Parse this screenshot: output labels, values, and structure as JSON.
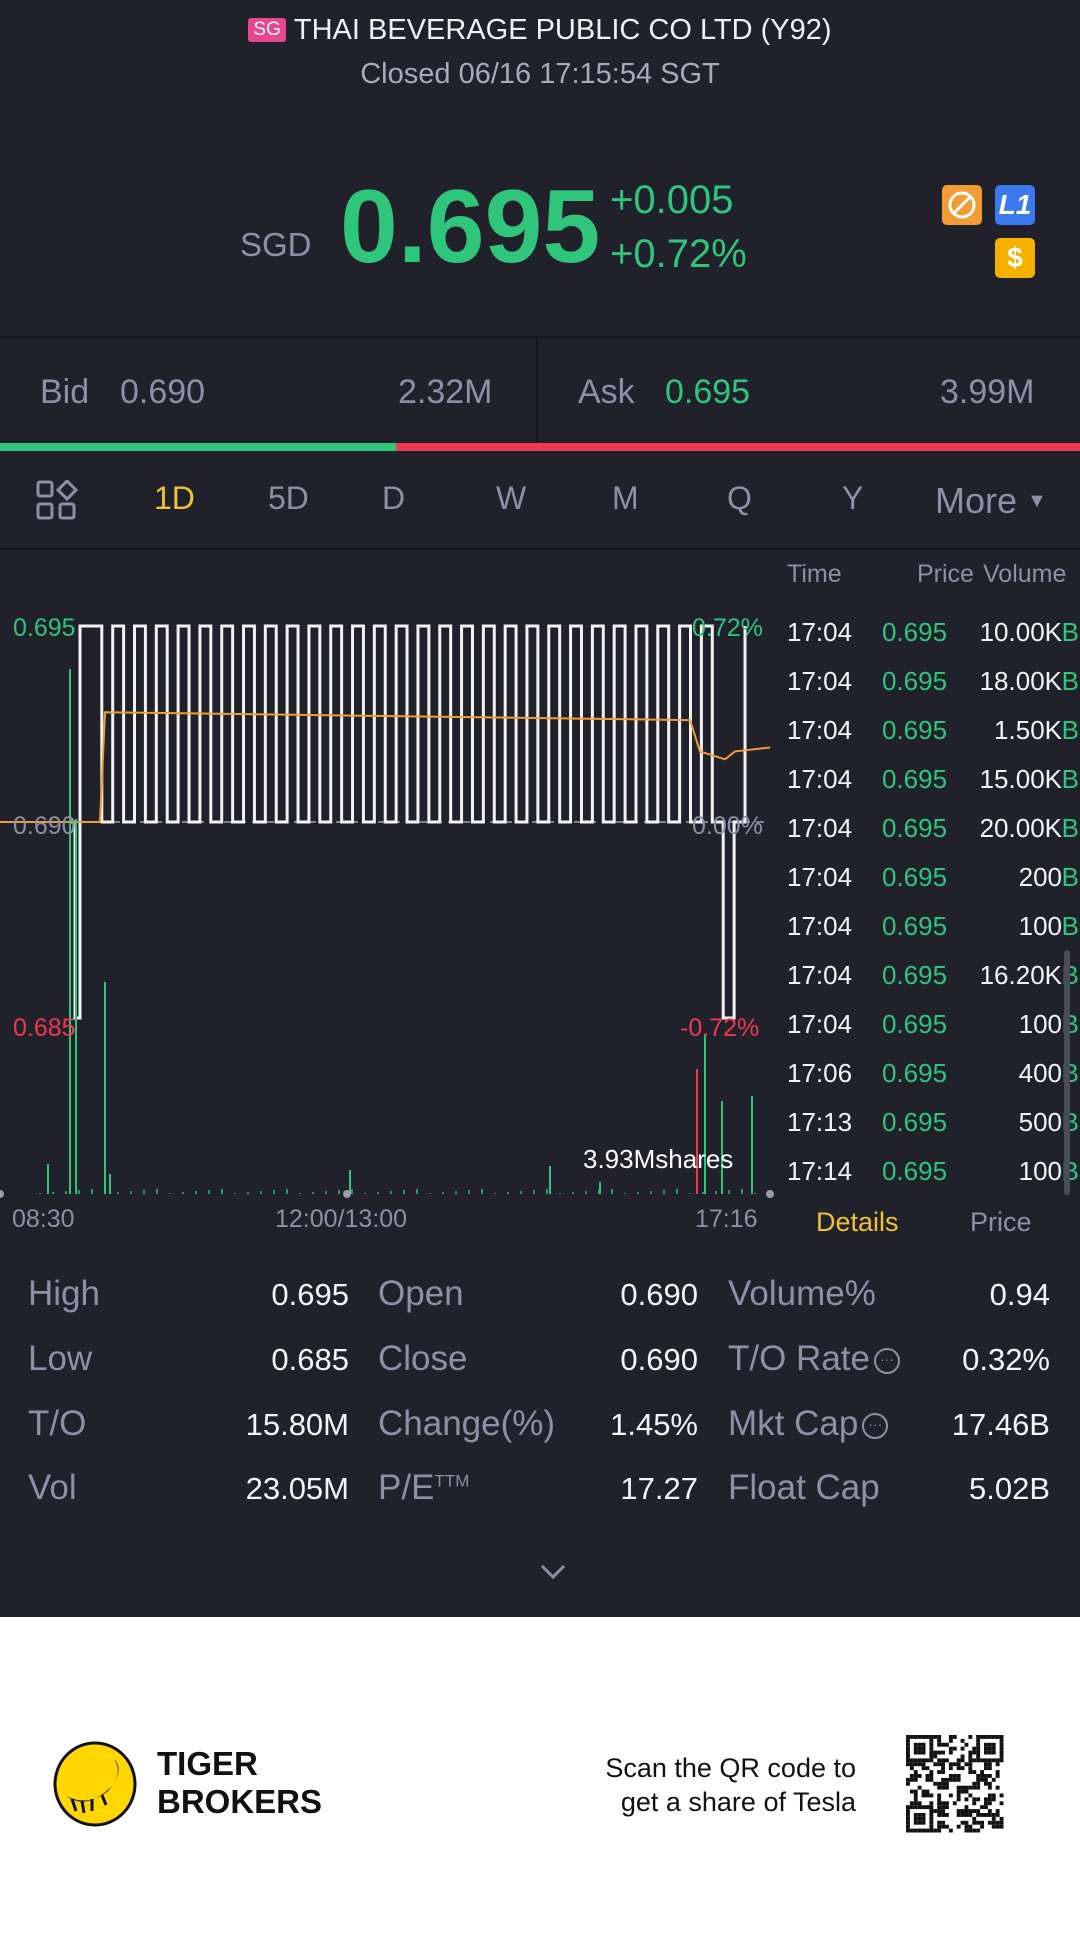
{
  "header": {
    "market_badge": "SG",
    "title": "THAI BEVERAGE PUBLIC CO LTD (Y92)",
    "status": "Closed 06/16 17:15:54 SGT"
  },
  "quote": {
    "currency": "SGD",
    "price": "0.695",
    "change": "+0.005",
    "change_pct": "+0.72%",
    "badges": [
      {
        "icon": "no-short-icon",
        "color": "#f39c34"
      },
      {
        "label": "L1",
        "color": "#3a79ee"
      },
      {
        "label": "$",
        "color": "#f6b000"
      }
    ]
  },
  "bidask": {
    "bid_label": "Bid",
    "bid_price": "0.690",
    "bid_size": "2.32M",
    "ask_label": "Ask",
    "ask_price": "0.695",
    "ask_size": "3.99M",
    "bid_ratio": 0.367
  },
  "tabs": {
    "items": [
      "1D",
      "5D",
      "D",
      "W",
      "M",
      "Q",
      "Y"
    ],
    "active": "1D",
    "more": "More"
  },
  "chart": {
    "y_high": "0.695",
    "y_mid": "0.690",
    "y_low": "0.685",
    "pct_high": "0.72%",
    "pct_mid": "0.00%",
    "pct_low": "-0.72%",
    "volume_label": "3.93Mshares",
    "x_labels": [
      "08:30",
      "12:00/13:00",
      "17:16"
    ],
    "price_series": [
      0.69,
      0.685,
      0.69,
      0.695,
      0.695,
      0.69,
      0.695,
      0.69,
      0.695,
      0.69,
      0.695,
      0.69,
      0.695,
      0.69,
      0.695,
      0.69,
      0.695,
      0.69,
      0.695,
      0.69,
      0.695,
      0.69,
      0.695,
      0.69,
      0.695,
      0.69,
      0.695,
      0.69,
      0.695,
      0.69,
      0.695,
      0.69,
      0.695,
      0.69,
      0.695,
      0.69,
      0.695,
      0.69,
      0.695,
      0.69,
      0.695,
      0.69,
      0.695,
      0.69,
      0.695,
      0.69,
      0.695,
      0.69,
      0.695,
      0.69,
      0.695,
      0.69,
      0.695,
      0.69,
      0.695,
      0.69,
      0.695,
      0.69,
      0.695,
      0.69,
      0.695,
      0.69,
      0.685,
      0.69,
      0.695
    ]
  },
  "trades": {
    "headers": [
      "Time",
      "Price",
      "Volume"
    ],
    "rows": [
      [
        "17:04",
        "0.695",
        "10.00K",
        "B"
      ],
      [
        "17:04",
        "0.695",
        "18.00K",
        "B"
      ],
      [
        "17:04",
        "0.695",
        "1.50K",
        "B"
      ],
      [
        "17:04",
        "0.695",
        "15.00K",
        "B"
      ],
      [
        "17:04",
        "0.695",
        "20.00K",
        "B"
      ],
      [
        "17:04",
        "0.695",
        "200",
        "B"
      ],
      [
        "17:04",
        "0.695",
        "100",
        "B"
      ],
      [
        "17:04",
        "0.695",
        "16.20K",
        "B"
      ],
      [
        "17:04",
        "0.695",
        "100",
        "B"
      ],
      [
        "17:06",
        "0.695",
        "400",
        "B"
      ],
      [
        "17:13",
        "0.695",
        "500",
        "B"
      ],
      [
        "17:14",
        "0.695",
        "100",
        "B"
      ]
    ],
    "tab_details": "Details",
    "tab_price": "Price"
  },
  "stats": [
    [
      "High",
      "0.695",
      "Open",
      "0.690",
      "Volume%",
      "0.94"
    ],
    [
      "Low",
      "0.685",
      "Close",
      "0.690",
      "T/O Rate",
      "0.32%"
    ],
    [
      "T/O",
      "15.80M",
      "Change(%)",
      "1.45%",
      "Mkt Cap",
      "17.46B"
    ],
    [
      "Vol",
      "23.05M",
      "P/E",
      "17.27",
      "Float Cap",
      "5.02B"
    ]
  ],
  "pe_sup": "TTM",
  "footer": {
    "brand_line1": "TIGER",
    "brand_line2": "BROKERS",
    "promo_line1": "Scan the QR code to",
    "promo_line2": "get a share of Tesla"
  }
}
